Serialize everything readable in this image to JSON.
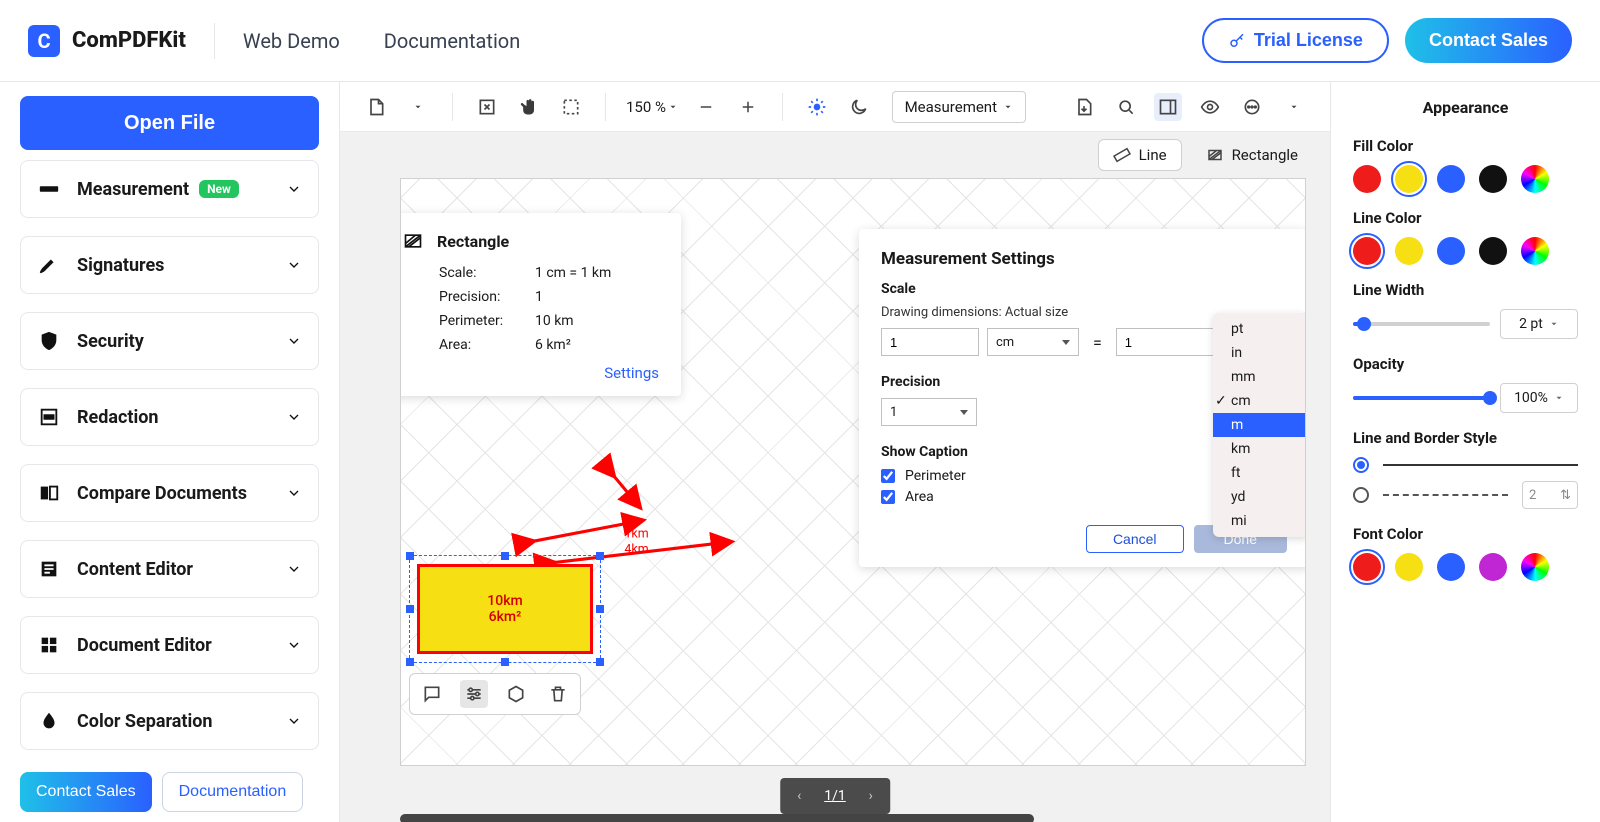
{
  "header": {
    "brand": "ComPDFKit",
    "nav": {
      "web_demo": "Web Demo",
      "documentation": "Documentation"
    },
    "trial_label": "Trial License",
    "contact_label": "Contact Sales"
  },
  "left": {
    "open_file": "Open File",
    "items": [
      {
        "label": "Measurement",
        "badge": "New",
        "icon": "ruler"
      },
      {
        "label": "Signatures",
        "icon": "pen"
      },
      {
        "label": "Security",
        "icon": "shield"
      },
      {
        "label": "Redaction",
        "icon": "redact"
      },
      {
        "label": "Compare Documents",
        "icon": "compare"
      },
      {
        "label": "Content Editor",
        "icon": "content"
      },
      {
        "label": "Document Editor",
        "icon": "grid"
      },
      {
        "label": "Color Separation",
        "icon": "drop"
      }
    ],
    "bottom": {
      "contact": "Contact Sales",
      "docs": "Documentation"
    }
  },
  "toolbar": {
    "zoom": "150 %",
    "mode": "Measurement"
  },
  "subtabs": {
    "line": "Line",
    "rectangle": "Rectangle"
  },
  "info": {
    "title": "Rectangle",
    "scale_lbl": "Scale:",
    "scale_val": "1 cm = 1 km",
    "prec_lbl": "Precision:",
    "prec_val": "1",
    "perim_lbl": "Perimeter:",
    "perim_val": "10 km",
    "area_lbl": "Area:",
    "area_val": "6 km²",
    "settings": "Settings"
  },
  "settings": {
    "title": "Measurement Settings",
    "scale": "Scale",
    "note": "Drawing dimensions: Actual size",
    "val1": "1",
    "unit1": "cm",
    "eq": "=",
    "val2": "1",
    "precision": "Precision",
    "precision_val": "1",
    "show_caption": "Show Caption",
    "perimeter": "Perimeter",
    "area": "Area",
    "cancel": "Cancel",
    "done": "Done"
  },
  "unit_options": [
    "pt",
    "in",
    "mm",
    "cm",
    "m",
    "km",
    "ft",
    "yd",
    "mi"
  ],
  "unit_checked": "cm",
  "unit_selected": "m",
  "shape": {
    "caption1": "10km",
    "caption2": "6km²"
  },
  "pager": {
    "text": "1/1"
  },
  "appearance": {
    "title": "Appearance",
    "fill_color": "Fill Color",
    "line_color": "Line Color",
    "line_width": "Line Width",
    "line_width_val": "2 pt",
    "opacity": "Opacity",
    "opacity_val": "100%",
    "line_style": "Line and Border Style",
    "dash_val": "2",
    "font_color": "Font Color",
    "palette": {
      "red": "#ef1c1c",
      "yellow": "#f6df12",
      "blue": "#2a60ff",
      "black": "#111111",
      "magenta": "#c026d3"
    }
  }
}
